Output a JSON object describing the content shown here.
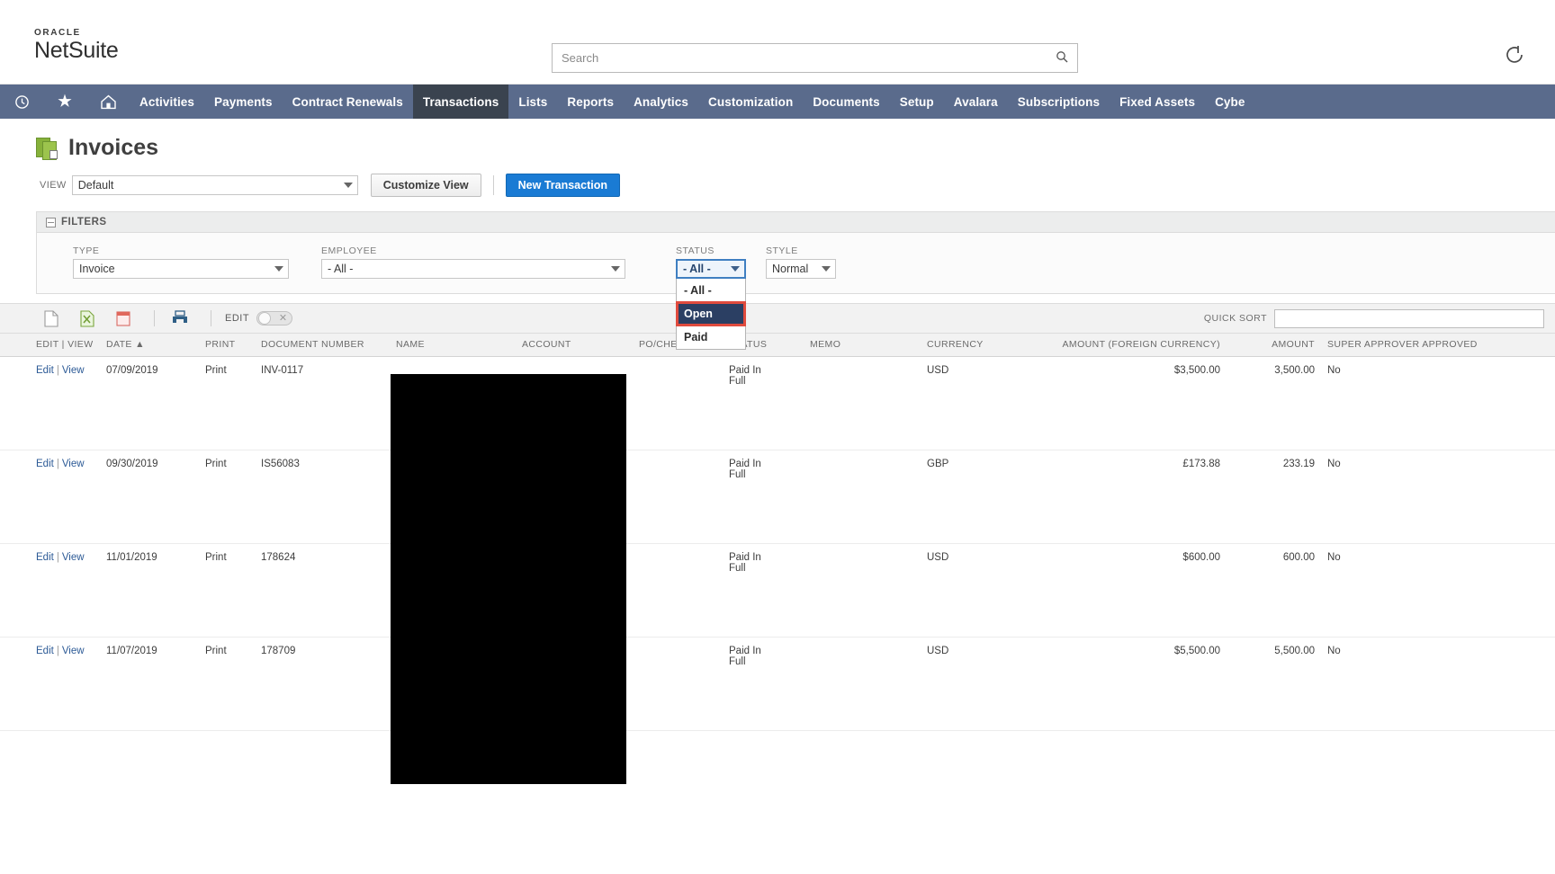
{
  "app": {
    "brand_top": "ORACLE",
    "brand_main": "NetSuite",
    "accent_blue": "#1a7bd4",
    "nav_bg": "#5a6b8c",
    "nav_active_bg": "#3a434f",
    "highlight_red": "#e04b3e"
  },
  "search": {
    "placeholder": "Search",
    "value": "",
    "icon": "search-icon"
  },
  "topright": {
    "icon": "logout-icon",
    "glyph": "↪"
  },
  "nav": {
    "icons": [
      {
        "name": "recent-records-icon",
        "glyph": "↺"
      },
      {
        "name": "favorites-icon",
        "glyph": "★"
      },
      {
        "name": "home-icon",
        "glyph": "⌂"
      }
    ],
    "items": [
      {
        "label": "Activities",
        "active": false
      },
      {
        "label": "Payments",
        "active": false
      },
      {
        "label": "Contract Renewals",
        "active": false
      },
      {
        "label": "Transactions",
        "active": true
      },
      {
        "label": "Lists",
        "active": false
      },
      {
        "label": "Reports",
        "active": false
      },
      {
        "label": "Analytics",
        "active": false
      },
      {
        "label": "Customization",
        "active": false
      },
      {
        "label": "Documents",
        "active": false
      },
      {
        "label": "Setup",
        "active": false
      },
      {
        "label": "Avalara",
        "active": false
      },
      {
        "label": "Subscriptions",
        "active": false
      },
      {
        "label": "Fixed Assets",
        "active": false
      },
      {
        "label": "Cybe",
        "active": false
      }
    ]
  },
  "page": {
    "title": "Invoices",
    "title_icon": "invoices-icon"
  },
  "viewbar": {
    "view_label": "VIEW",
    "view_value": "Default",
    "customize_label": "Customize View",
    "new_transaction_label": "New Transaction"
  },
  "filters": {
    "header": "FILTERS",
    "fields": [
      {
        "label": "TYPE",
        "value": "Invoice"
      },
      {
        "label": "EMPLOYEE",
        "value": "- All -"
      },
      {
        "label": "STATUS",
        "value": "- All -"
      },
      {
        "label": "STYLE",
        "value": "Normal"
      }
    ],
    "status_dropdown": {
      "open": true,
      "options": [
        {
          "label": "- All -",
          "selected": false
        },
        {
          "label": "Open",
          "selected": true
        },
        {
          "label": "Paid",
          "selected": false
        }
      ]
    }
  },
  "toolbar": {
    "icons": [
      {
        "name": "export-csv-icon"
      },
      {
        "name": "export-excel-icon"
      },
      {
        "name": "export-pdf-icon"
      },
      {
        "name": "print-icon"
      }
    ],
    "edit_label": "EDIT",
    "quick_sort_label": "QUICK SORT",
    "quick_sort_value": ""
  },
  "table": {
    "columns": [
      "EDIT | VIEW",
      "DATE ▲",
      "PRINT",
      "DOCUMENT NUMBER",
      "NAME",
      "ACCOUNT",
      "PO/CHECK NUMBER",
      "STATUS",
      "MEMO",
      "CURRENCY",
      "AMOUNT (FOREIGN CURRENCY)",
      "AMOUNT",
      "SUPER APPROVER APPROVED"
    ],
    "edit_label": "Edit",
    "view_label": "View",
    "print_label": "Print",
    "rows": [
      {
        "date": "07/09/2019",
        "document_number": "INV-0117",
        "name": "",
        "account": "",
        "po_check_number": "",
        "status": "Paid In Full",
        "memo": "",
        "currency": "USD",
        "amount_foreign": "$3,500.00",
        "amount": "3,500.00",
        "super_approver_approved": "No"
      },
      {
        "date": "09/30/2019",
        "document_number": "IS56083",
        "name": "",
        "account": "",
        "po_check_number": "",
        "status": "Paid In Full",
        "memo": "",
        "currency": "GBP",
        "amount_foreign": "£173.88",
        "amount": "233.19",
        "super_approver_approved": "No"
      },
      {
        "date": "11/01/2019",
        "document_number": "178624",
        "name": "",
        "account": "",
        "po_check_number": "",
        "status": "Paid In Full",
        "memo": "",
        "currency": "USD",
        "amount_foreign": "$600.00",
        "amount": "600.00",
        "super_approver_approved": "No"
      },
      {
        "date": "11/07/2019",
        "document_number": "178709",
        "name": "",
        "account": "",
        "po_check_number": "",
        "status": "Paid In Full",
        "memo": "",
        "currency": "USD",
        "amount_foreign": "$5,500.00",
        "amount": "5,500.00",
        "super_approver_approved": "No"
      }
    ]
  }
}
